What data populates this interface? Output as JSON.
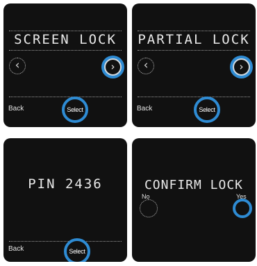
{
  "colors": {
    "panel_bg": "#111111",
    "accent": "#2e8bd3",
    "text": "#e9e9e9"
  },
  "screens": [
    {
      "title": "SCREEN LOCK",
      "left_icon": "chevron-left-icon",
      "right_icon": "chevron-right-icon",
      "back_label": "Back",
      "select_label": "Select"
    },
    {
      "title": "PARTIAL LOCK",
      "left_icon": "chevron-left-icon",
      "right_icon": "chevron-right-icon",
      "back_label": "Back",
      "select_label": "Select"
    },
    {
      "title": "PIN 2436",
      "back_label": "Back",
      "select_label": "Select"
    },
    {
      "title": "CONFIRM LOCK",
      "no_label": "No",
      "yes_label": "Yes"
    }
  ]
}
